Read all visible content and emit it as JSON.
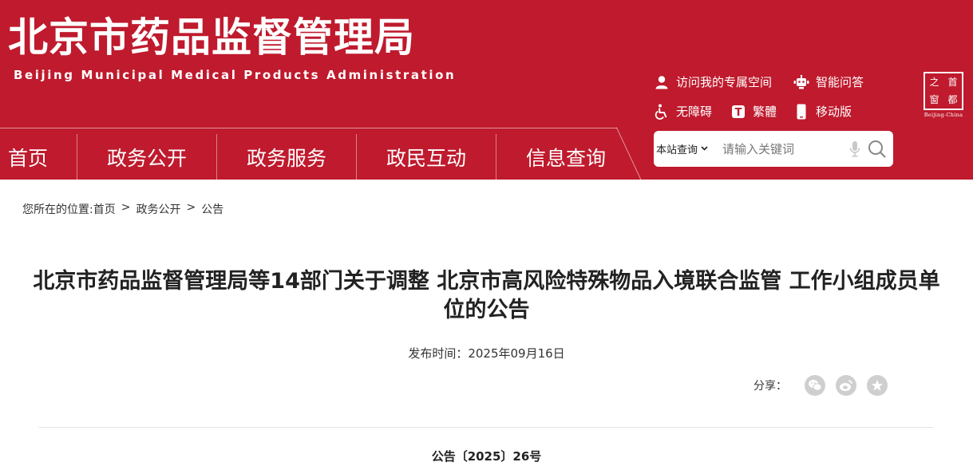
{
  "header": {
    "title": "北京市药品监督管理局",
    "subtitle": "Beijing Municipal Medical Products Administration",
    "tools": {
      "personal_space": "访问我的专属空间",
      "smart_qa": "智能问答",
      "accessibility": "无障碍",
      "traditional": "繁體",
      "traditional_icon_glyph": "T",
      "mobile": "移动版"
    },
    "seal": {
      "c1": "之",
      "c2": "首",
      "c3": "窗",
      "c4": "都",
      "caption": "Beijing-China"
    }
  },
  "nav": {
    "items": [
      "首页",
      "政务公开",
      "政务服务",
      "政民互动",
      "信息查询"
    ]
  },
  "search": {
    "scope": "本站查询",
    "placeholder": "请输入关键词"
  },
  "breadcrumb": {
    "prefix": "您所在的位置:",
    "items": [
      "首页",
      "政务公开",
      "公告"
    ],
    "separator": ">"
  },
  "article": {
    "title": "北京市药品监督管理局等14部门关于调整 北京市高风险特殊物品入境联合监管 工作小组成员单位的公告",
    "publish_time": "发布时间：2025年09月16日",
    "share_label": "分享：",
    "doc_number": "公告〔2025〕26号"
  },
  "colors": {
    "brand_red": "#bf1a2d",
    "share_gray": "#cfcfcf"
  }
}
